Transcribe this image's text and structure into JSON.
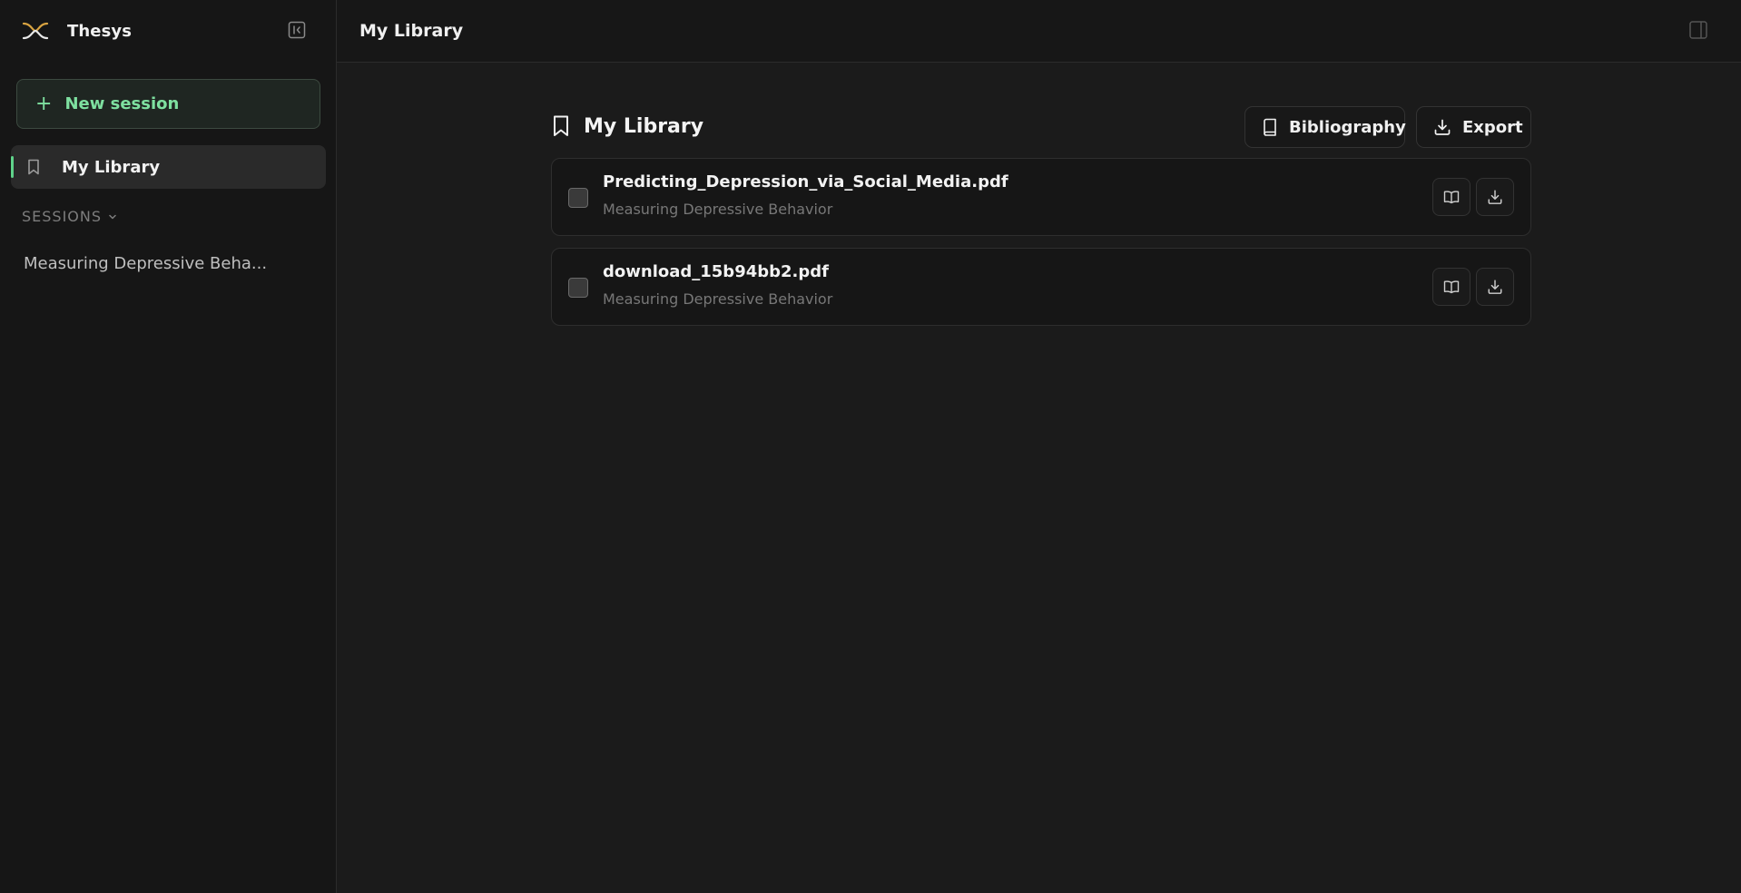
{
  "sidebar": {
    "app_name": "Thesys",
    "new_session_label": "New session",
    "library_label": "My Library",
    "sessions_header": "SESSIONS",
    "sessions": [
      {
        "label": "Measuring Depressive Beha..."
      }
    ]
  },
  "topbar": {
    "title": "My Library"
  },
  "library": {
    "title": "My Library",
    "bibliography_label": "Bibliography",
    "export_label": "Export",
    "documents": [
      {
        "name": "Predicting_Depression_via_Social_Media.pdf",
        "session": "Measuring Depressive Behavior",
        "checked": false
      },
      {
        "name": "download_15b94bb2.pdf",
        "session": "Measuring Depressive Behavior",
        "checked": false
      }
    ]
  },
  "colors": {
    "accent_green": "#7ee0a0",
    "active_indicator": "#5fd38a",
    "logo_gold": "#d9a441",
    "background": "#1b1b1b",
    "sidebar_bg": "#161616"
  },
  "icons": {
    "logo": "thesys-logo",
    "collapse": "sidebar-collapse-icon",
    "panel": "panel-toggle-icon",
    "library": "bookmark-icon",
    "bibliography": "book-icon",
    "export": "download-icon",
    "doc_open": "open-book-icon",
    "doc_download": "download-icon"
  }
}
